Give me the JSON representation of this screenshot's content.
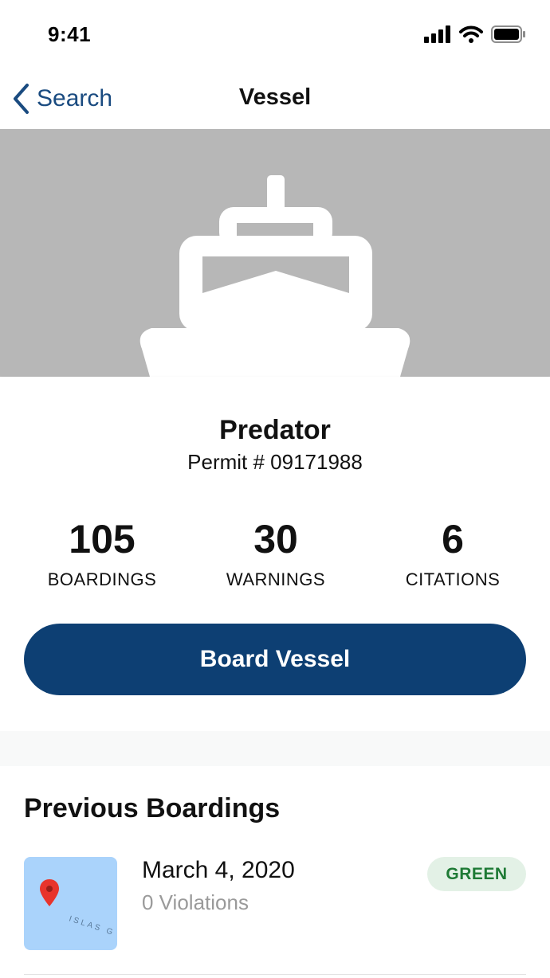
{
  "status_bar": {
    "time": "9:41",
    "icons": [
      "signal-icon",
      "wifi-icon",
      "battery-icon"
    ]
  },
  "nav": {
    "back_label": "Search",
    "back_icon": "chevron-left-icon",
    "title": "Vessel"
  },
  "hero": {
    "icon": "ship-icon",
    "background": "#b7b7b7"
  },
  "vessel": {
    "name": "Predator",
    "permit": "Permit # 09171988"
  },
  "stats": [
    {
      "value": "105",
      "label": "BOARDINGS"
    },
    {
      "value": "30",
      "label": "WARNINGS"
    },
    {
      "value": "6",
      "label": "CITATIONS"
    }
  ],
  "actions": {
    "board_label": "Board Vessel",
    "board_color": "#0d3f73"
  },
  "boardings": {
    "title": "Previous Boardings",
    "items": [
      {
        "date": "March 4, 2020",
        "violations": "0 Violations",
        "status": "GREEN",
        "status_color": "#1e7a35",
        "map_label": "ISLAS G"
      }
    ]
  }
}
